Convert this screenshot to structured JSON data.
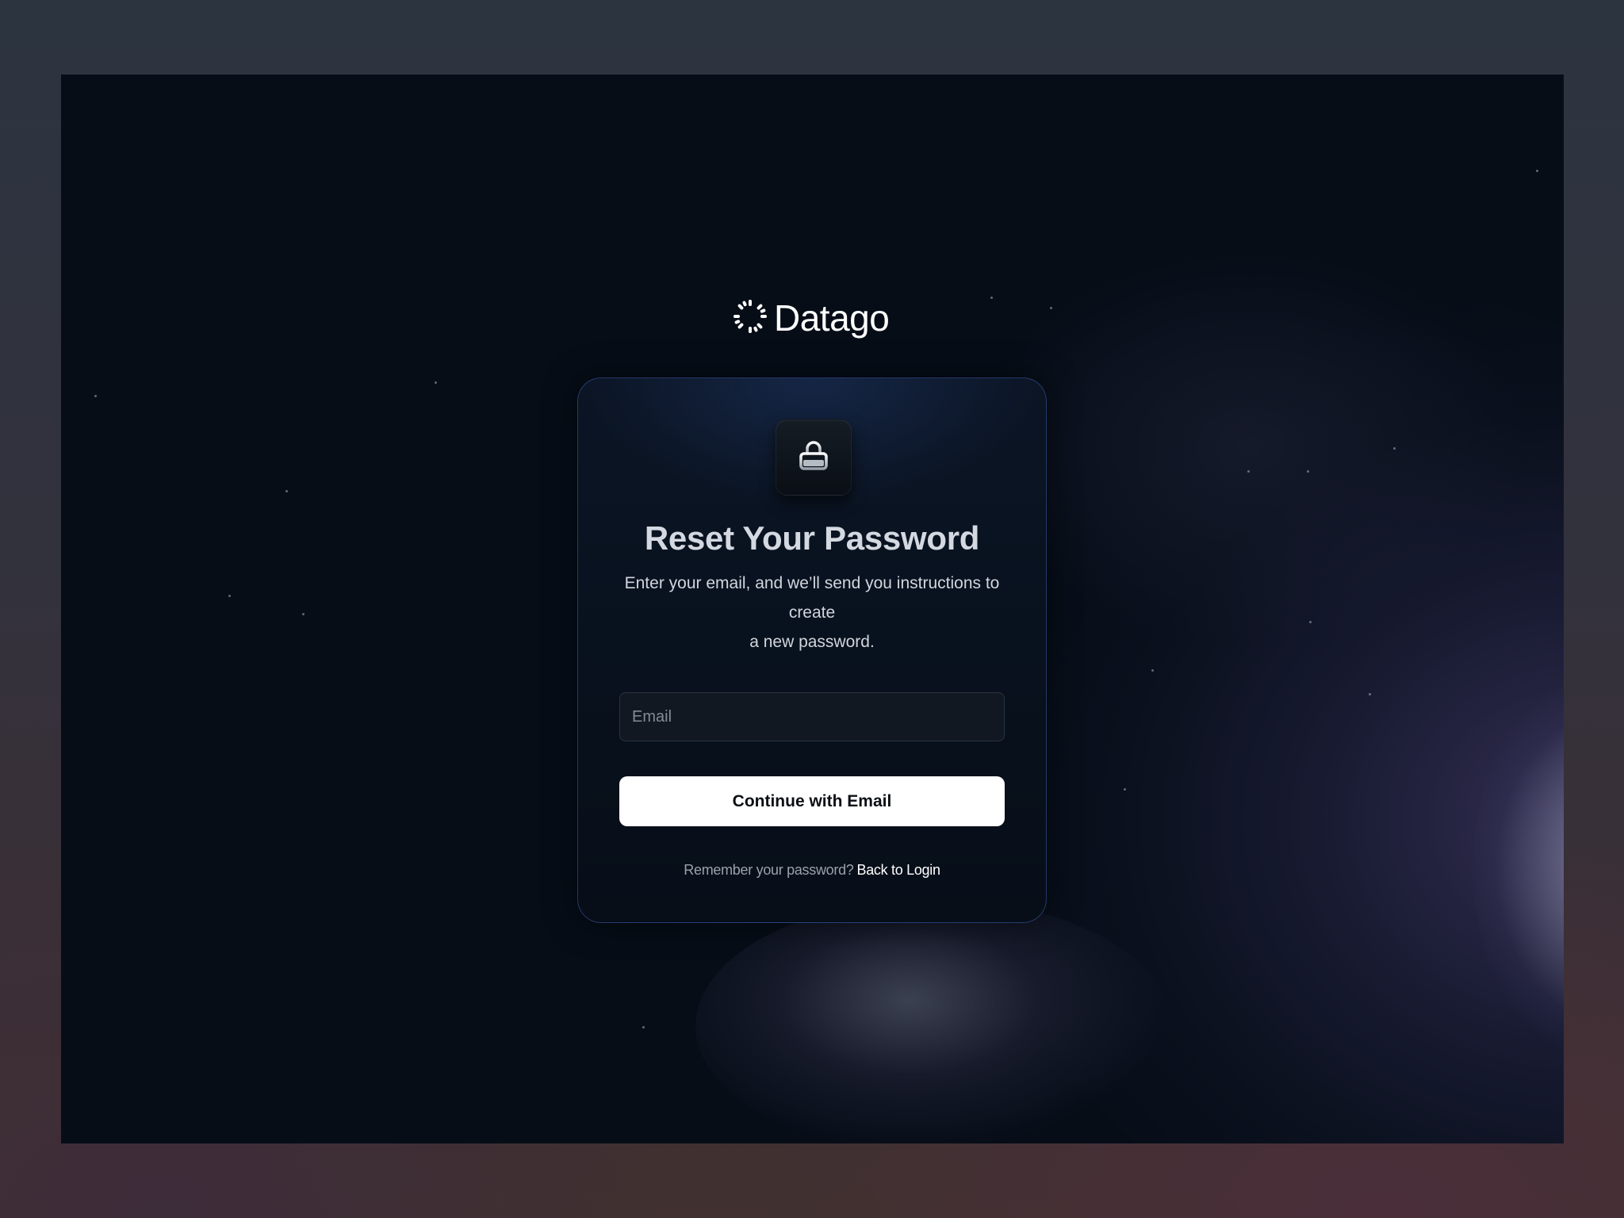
{
  "brand": {
    "name": "Datago",
    "logo_icon": "dotted-circle-logo-icon"
  },
  "card": {
    "icon": "lock-icon",
    "title": "Reset Your Password",
    "subtitle_lines": [
      "Enter your email, and we’ll send you instructions to",
      "create",
      "a new password."
    ],
    "email": {
      "placeholder": "Email",
      "value": ""
    },
    "continue_label": "Continue with Email",
    "footer": {
      "prompt": "Remember your password?",
      "link_label": "Back to Login"
    }
  },
  "colors": {
    "background": "#060d17",
    "card_border": "#3c5aaa",
    "button": "#ffffff",
    "title": "#d4d9e1"
  }
}
